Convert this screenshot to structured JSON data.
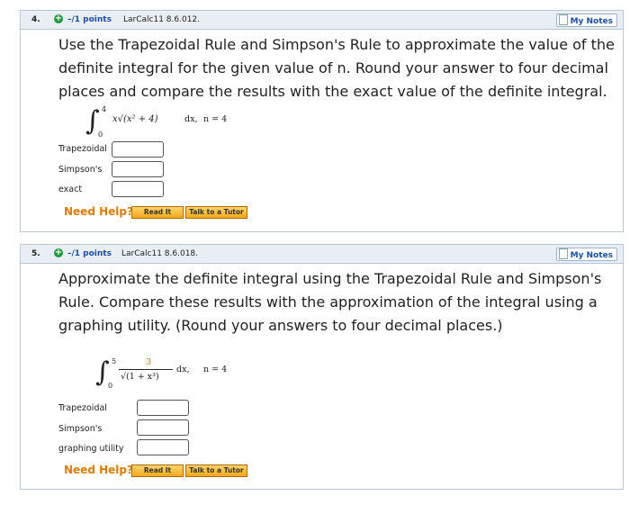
{
  "questions": [
    {
      "number": "4.",
      "points": "–/1 points",
      "source": "LarCalc11 8.6.012.",
      "my_notes": "My Notes",
      "text": "Use the Trapezoidal Rule and Simpson's Rule to approximate the value of the definite integral for the given value of n. Round your answer to four decimal places and compare the results with the exact value of the definite integral.",
      "integral": {
        "lower": "0",
        "upper": "4",
        "integrand": "x√(x² + 4)",
        "dx": "dx,",
        "n": "n = 4"
      },
      "answers": [
        {
          "label": "Trapezoidal",
          "value": ""
        },
        {
          "label": "Simpson's",
          "value": ""
        },
        {
          "label": "exact",
          "value": ""
        }
      ],
      "need_help": "Need Help?",
      "read_it": "Read It",
      "talk_tutor": "Talk to a Tutor"
    },
    {
      "number": "5.",
      "points": "–/1 points",
      "source": "LarCalc11 8.6.018.",
      "my_notes": "My Notes",
      "text": "Approximate the definite integral using the Trapezoidal Rule and Simpson's Rule. Compare these results with the approximation of the integral using a graphing utility. (Round your answers to four decimal places.)",
      "integral": {
        "lower": "0",
        "upper": "5",
        "numerator": "3",
        "denominator": "√(1 + x³)",
        "dx": "dx,",
        "n": "n = 4"
      },
      "answers": [
        {
          "label": "Trapezoidal",
          "value": ""
        },
        {
          "label": "Simpson's",
          "value": ""
        },
        {
          "label": "graphing utility",
          "value": ""
        }
      ],
      "need_help": "Need Help?",
      "read_it": "Read It",
      "talk_tutor": "Talk to a Tutor"
    }
  ],
  "colors": {
    "header_bg": "#e9eef4",
    "border": "#b9c8d8",
    "points_blue": "#1b4fa3",
    "help_orange": "#e07b00",
    "plus_green": "#1d9a3a"
  }
}
